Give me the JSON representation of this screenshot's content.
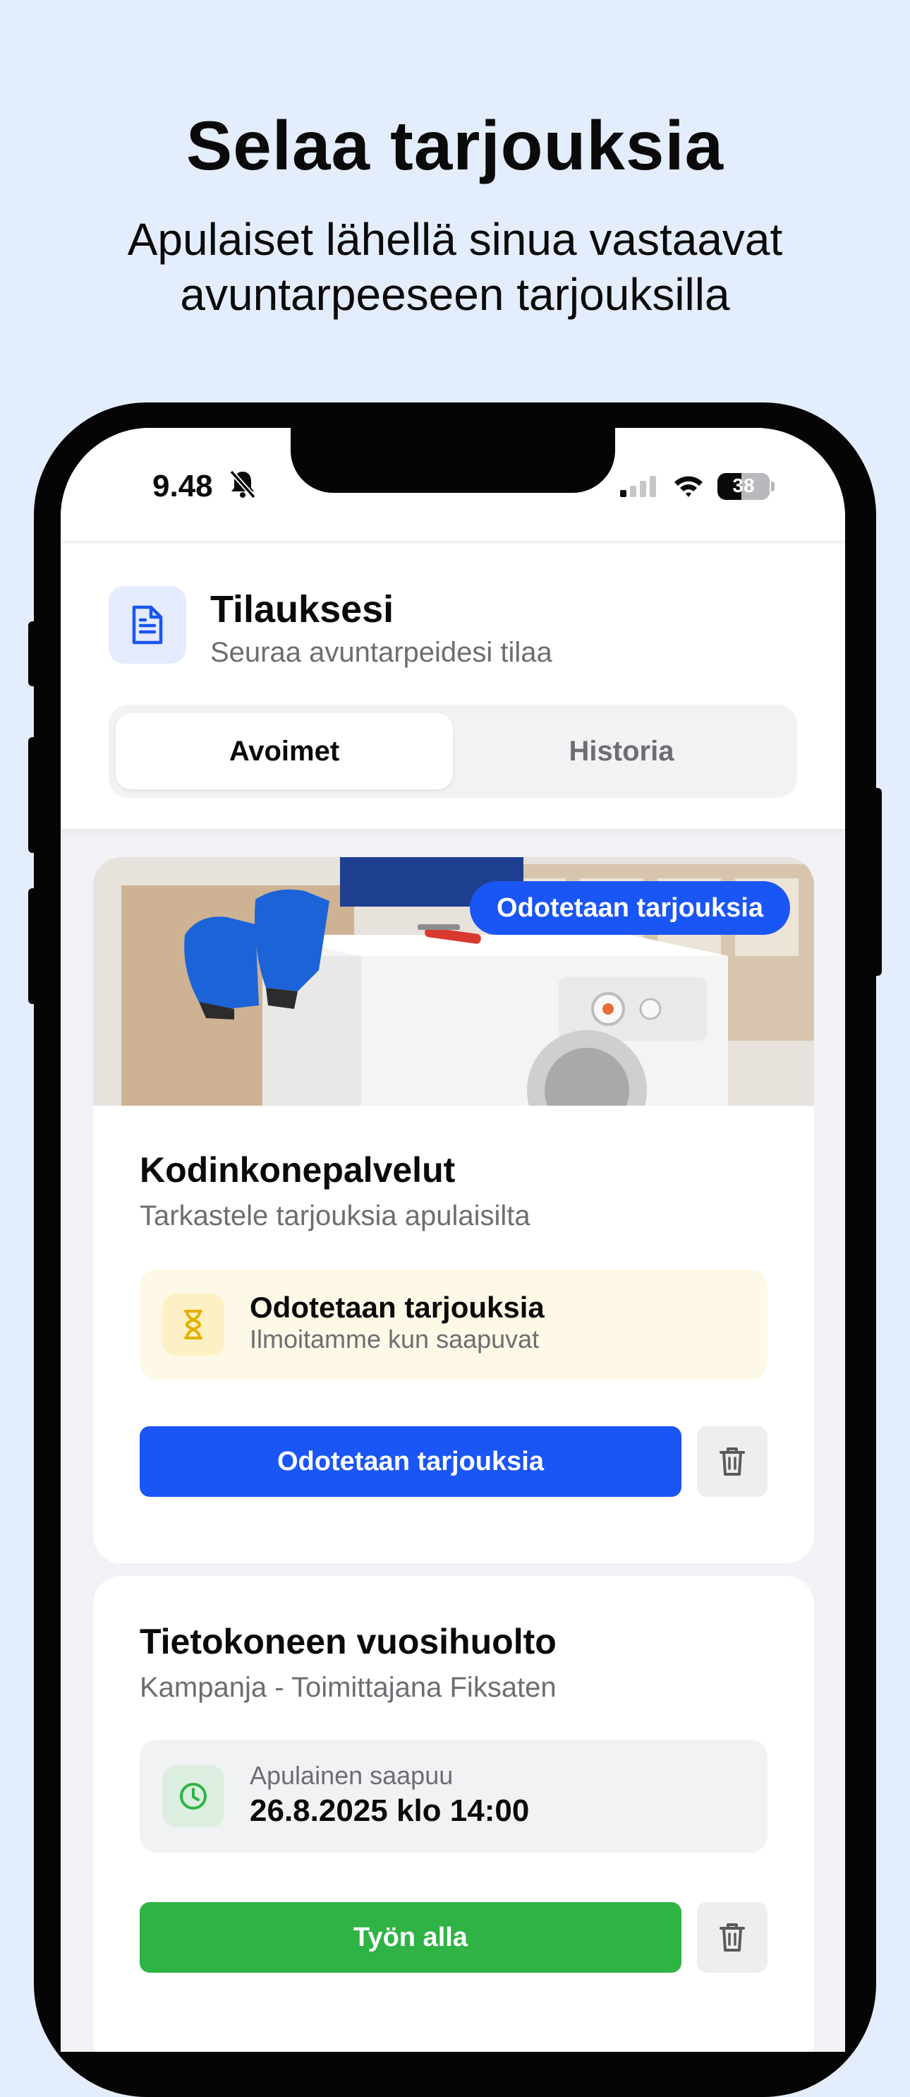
{
  "hero": {
    "title": "Selaa tarjouksia",
    "subtitle_line1": "Apulaiset lähellä sinua vastaavat",
    "subtitle_line2": "avuntarpeeseen tarjouksilla"
  },
  "status_bar": {
    "time": "9.48",
    "battery": "38"
  },
  "header": {
    "icon": "document-icon",
    "title": "Tilauksesi",
    "subtitle": "Seuraa avuntarpeidesi tilaa"
  },
  "tabs": [
    {
      "label": "Avoimet",
      "active": true
    },
    {
      "label": "Historia",
      "active": false
    }
  ],
  "orders": [
    {
      "badge": "Odotetaan tarjouksia",
      "title": "Kodinkonepalvelut",
      "subtitle": "Tarkastele tarjouksia apulaisilta",
      "status_title": "Odotetaan tarjouksia",
      "status_text": "Ilmoitamme kun saapuvat",
      "status_icon": "hourglass-icon",
      "button_label": "Odotetaan tarjouksia",
      "button_color": "#1a55f5"
    },
    {
      "title": "Tietokoneen vuosihuolto",
      "subtitle": "Kampanja - Toimittajana Fiksaten",
      "status_label": "Apulainen saapuu",
      "status_value": "26.8.2025 klo 14:00",
      "status_icon": "clock-icon",
      "button_label": "Työn alla",
      "button_color": "#2fb344"
    }
  ],
  "colors": {
    "page_background": "#e4edfc",
    "primary": "#1a55f5",
    "success": "#2fb344",
    "pending_box": "#fef9e6"
  }
}
